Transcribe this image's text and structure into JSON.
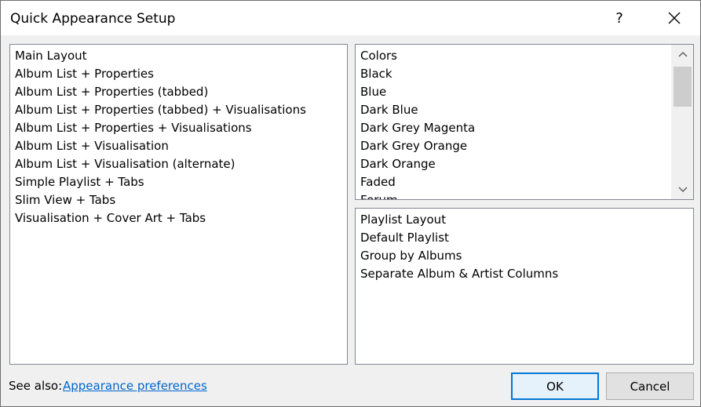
{
  "window": {
    "title": "Quick Appearance Setup",
    "help_label": "?"
  },
  "main_layout": {
    "items": [
      "Main Layout",
      "Album List + Properties",
      "Album List + Properties (tabbed)",
      "Album List + Properties (tabbed) + Visualisations",
      "Album List + Properties + Visualisations",
      "Album List + Visualisation",
      "Album List + Visualisation (alternate)",
      "Simple Playlist + Tabs",
      "Slim View + Tabs",
      "Visualisation + Cover Art + Tabs"
    ]
  },
  "colors": {
    "items": [
      "Colors",
      "Black",
      "Blue",
      "Dark Blue",
      "Dark Grey Magenta",
      "Dark Grey Orange",
      "Dark Orange",
      "Faded",
      "Forum"
    ],
    "scrollbar_icons": [
      "chevron-up-icon",
      "chevron-down-icon"
    ]
  },
  "playlist_layout": {
    "items": [
      "Playlist Layout",
      "Default Playlist",
      "Group by Albums",
      "Separate Album & Artist Columns"
    ]
  },
  "footer": {
    "see_also_label": "See also:",
    "link_label": "Appearance preferences",
    "ok_label": "OK",
    "cancel_label": "Cancel"
  },
  "colors_accent": {
    "link": "#0066cc",
    "default_button_border": "#0078d7"
  }
}
